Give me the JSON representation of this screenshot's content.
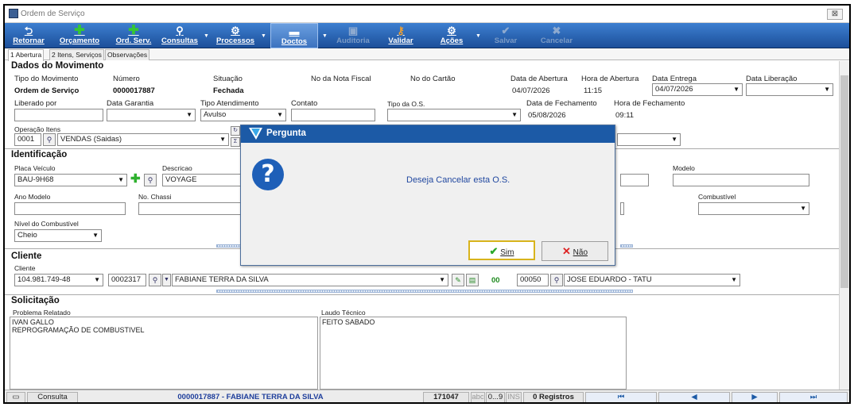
{
  "window": {
    "title": "Ordem de Serviço",
    "close": "⊠"
  },
  "toolbar": {
    "retornar": "Retornar",
    "orcamento": "Orçamento",
    "ord_serv": "Ord. Serv.",
    "consultas": "Consultas",
    "processos": "Processos",
    "doctos": "Doctos",
    "auditoria": "Auditoria",
    "validar": "Validar",
    "acoes": "Ações",
    "salvar": "Salvar",
    "cancelar": "Cancelar"
  },
  "tabs": [
    "1 Abertura",
    "2 Itens, Serviços",
    "Observações"
  ],
  "dados": {
    "section": "Dados do Movimento",
    "tipo_mov_label": "Tipo do Movimento",
    "tipo_mov": "Ordem de Serviço",
    "numero_label": "Número",
    "numero": "0000017887",
    "situacao_label": "Situação",
    "situacao": "Fechada",
    "nota_label": "No da Nota Fiscal",
    "cartao_label": "No do Cartão",
    "data_abertura_label": "Data de Abertura",
    "data_abertura": "04/07/2026",
    "hora_abertura_label": "Hora de Abertura",
    "hora_abertura": "11:15",
    "data_entrega_label": "Data Entrega",
    "data_entrega": "04/07/2026",
    "data_liberacao_label": "Data Liberação",
    "liberado_label": "Liberado por",
    "garantia_label": "Data Garantia",
    "tipo_atend_label": "Tipo Atendimento",
    "tipo_atend": "Avulso",
    "contato_label": "Contato",
    "tipo_os_label": "Tipo da O.S.",
    "data_fech_label": "Data de Fechamento",
    "data_fech": "05/08/2026",
    "hora_fech_label": "Hora de Fechamento",
    "hora_fech": "09:11",
    "operacao_label": "Operação Itens",
    "operacao_code": "0001",
    "operacao": "VENDAS (Saidas)"
  },
  "ident": {
    "section": "Identificação",
    "placa_label": "Placa Veículo",
    "placa": "BAU-9H68",
    "descricao_label": "Descricao",
    "descricao": "VOYAGE",
    "modelo_label": "Modelo",
    "ano_label": "Ano Modelo",
    "chassi_label": "No. Chassi",
    "combustivel_label": "Combustível",
    "nivel_label": "Nível do Combustível",
    "nivel": "Cheio"
  },
  "cliente": {
    "section": "Cliente",
    "label": "Cliente",
    "cpf": "104.981.749-48",
    "code": "0002317",
    "name": "FABIANE TERRA DA SILVA",
    "count": "00",
    "vend_code": "00050",
    "vendedor": "JOSE EDUARDO - TATU"
  },
  "solicitacao": {
    "section": "Solicitação",
    "problema_label": "Problema Relatado",
    "problema": "IVAN GALLO\nREPROGRAMAÇÃO DE COMBUSTIVEL",
    "laudo_label": "Laudo Técnico",
    "laudo": "FEITO SABADO"
  },
  "status": {
    "consulta": "Consulta",
    "record": "0000017887 - FABIANE TERRA DA SILVA",
    "num": "171047",
    "abc": "abc",
    "range": "0...9",
    "ins": "INS",
    "registros": "0 Registros"
  },
  "dialog": {
    "title": "Pergunta",
    "message": "Deseja Cancelar esta O.S.",
    "yes": "Sim",
    "no": "Não"
  },
  "colors": {
    "toolbar": "#1c4f9a",
    "dialog_header": "#1c5aa6",
    "accent_text": "#1f3f9c"
  }
}
